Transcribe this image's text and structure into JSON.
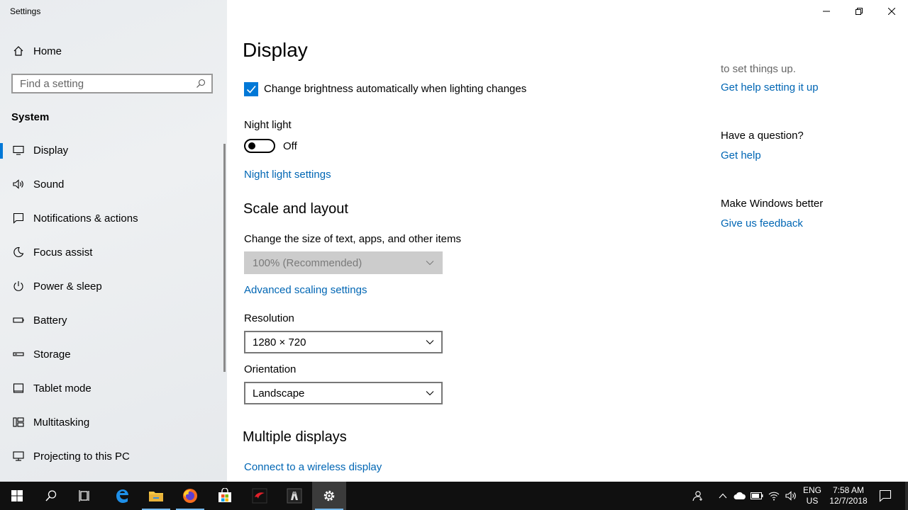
{
  "window": {
    "title": "Settings",
    "controls": {
      "minimize": "minimize-icon",
      "restore": "restore-icon",
      "close": "close-icon"
    }
  },
  "sidebar": {
    "home_label": "Home",
    "search_placeholder": "Find a setting",
    "section": "System",
    "items": [
      {
        "label": "Display",
        "icon": "monitor-icon",
        "active": true
      },
      {
        "label": "Sound",
        "icon": "speaker-icon"
      },
      {
        "label": "Notifications & actions",
        "icon": "notification-icon"
      },
      {
        "label": "Focus assist",
        "icon": "moon-icon"
      },
      {
        "label": "Power & sleep",
        "icon": "power-icon"
      },
      {
        "label": "Battery",
        "icon": "battery-icon"
      },
      {
        "label": "Storage",
        "icon": "storage-icon"
      },
      {
        "label": "Tablet mode",
        "icon": "tablet-icon"
      },
      {
        "label": "Multitasking",
        "icon": "multitasking-icon"
      },
      {
        "label": "Projecting to this PC",
        "icon": "projector-icon"
      }
    ]
  },
  "main": {
    "title": "Display",
    "brightness_checkbox": {
      "label": "Change brightness automatically when lighting changes",
      "checked": true
    },
    "night_light": {
      "heading": "Night light",
      "state": "Off",
      "settings_link": "Night light settings"
    },
    "scale_layout": {
      "heading": "Scale and layout",
      "size_label": "Change the size of text, apps, and other items",
      "size_value": "100% (Recommended)",
      "advanced_link": "Advanced scaling settings",
      "resolution_label": "Resolution",
      "resolution_value": "1280 × 720",
      "orientation_label": "Orientation",
      "orientation_value": "Landscape"
    },
    "multiple_displays": {
      "heading": "Multiple displays",
      "wireless_link": "Connect to a wireless display"
    }
  },
  "right": {
    "cutoff_text": "to set things up.",
    "help_setup_link": "Get help setting it up",
    "question_heading": "Have a question?",
    "get_help_link": "Get help",
    "better_heading": "Make Windows better",
    "feedback_link": "Give us feedback"
  },
  "taskbar": {
    "apps": [
      "start-icon",
      "search-icon",
      "task-view-icon",
      "edge-icon",
      "file-explorer-icon",
      "firefox-icon",
      "store-icon",
      "game-app-icon",
      "app-icon",
      "settings-gear-icon"
    ],
    "lang_line1": "ENG",
    "lang_line2": "US",
    "time": "7:58 AM",
    "date": "12/7/2018"
  },
  "colors": {
    "accent": "#0078d7",
    "link": "#0066b4",
    "taskbar": "#101010"
  }
}
